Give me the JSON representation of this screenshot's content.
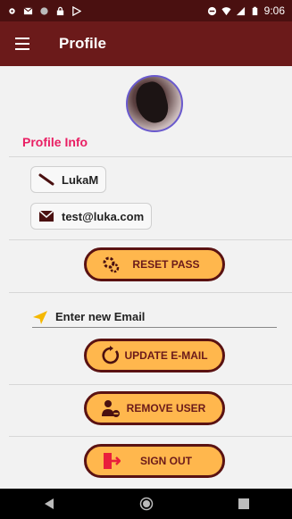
{
  "status_bar": {
    "time": "9:06"
  },
  "toolbar": {
    "title": "Profile",
    "menu_icon": "menu-icon"
  },
  "profile": {
    "section_title": "Profile Info",
    "username": "LukaM",
    "email": "test@luka.com"
  },
  "buttons": {
    "reset_pass": "RESET PASS",
    "update_email": "UPDATE E-MAIL",
    "remove_user": "REMOVE USER",
    "sign_out": "SIGN OUT"
  },
  "email_input": {
    "placeholder": "Enter new Email",
    "value": ""
  },
  "colors": {
    "toolbar": "#6b1a1a",
    "status_bar": "#4a1010",
    "accent_pink": "#e91e63",
    "button_fill": "#ffb74d",
    "button_border": "#5a1212"
  }
}
